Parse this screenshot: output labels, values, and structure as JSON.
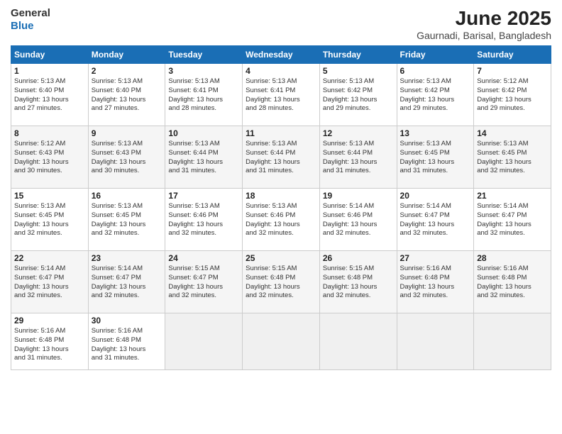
{
  "header": {
    "logo_line1": "General",
    "logo_line2": "Blue",
    "month": "June 2025",
    "location": "Gaurnadi, Barisal, Bangladesh"
  },
  "weekdays": [
    "Sunday",
    "Monday",
    "Tuesday",
    "Wednesday",
    "Thursday",
    "Friday",
    "Saturday"
  ],
  "weeks": [
    [
      {
        "day": "1",
        "info": "Sunrise: 5:13 AM\nSunset: 6:40 PM\nDaylight: 13 hours\nand 27 minutes."
      },
      {
        "day": "2",
        "info": "Sunrise: 5:13 AM\nSunset: 6:40 PM\nDaylight: 13 hours\nand 27 minutes."
      },
      {
        "day": "3",
        "info": "Sunrise: 5:13 AM\nSunset: 6:41 PM\nDaylight: 13 hours\nand 28 minutes."
      },
      {
        "day": "4",
        "info": "Sunrise: 5:13 AM\nSunset: 6:41 PM\nDaylight: 13 hours\nand 28 minutes."
      },
      {
        "day": "5",
        "info": "Sunrise: 5:13 AM\nSunset: 6:42 PM\nDaylight: 13 hours\nand 29 minutes."
      },
      {
        "day": "6",
        "info": "Sunrise: 5:13 AM\nSunset: 6:42 PM\nDaylight: 13 hours\nand 29 minutes."
      },
      {
        "day": "7",
        "info": "Sunrise: 5:12 AM\nSunset: 6:42 PM\nDaylight: 13 hours\nand 29 minutes."
      }
    ],
    [
      {
        "day": "8",
        "info": "Sunrise: 5:12 AM\nSunset: 6:43 PM\nDaylight: 13 hours\nand 30 minutes."
      },
      {
        "day": "9",
        "info": "Sunrise: 5:13 AM\nSunset: 6:43 PM\nDaylight: 13 hours\nand 30 minutes."
      },
      {
        "day": "10",
        "info": "Sunrise: 5:13 AM\nSunset: 6:44 PM\nDaylight: 13 hours\nand 31 minutes."
      },
      {
        "day": "11",
        "info": "Sunrise: 5:13 AM\nSunset: 6:44 PM\nDaylight: 13 hours\nand 31 minutes."
      },
      {
        "day": "12",
        "info": "Sunrise: 5:13 AM\nSunset: 6:44 PM\nDaylight: 13 hours\nand 31 minutes."
      },
      {
        "day": "13",
        "info": "Sunrise: 5:13 AM\nSunset: 6:45 PM\nDaylight: 13 hours\nand 31 minutes."
      },
      {
        "day": "14",
        "info": "Sunrise: 5:13 AM\nSunset: 6:45 PM\nDaylight: 13 hours\nand 32 minutes."
      }
    ],
    [
      {
        "day": "15",
        "info": "Sunrise: 5:13 AM\nSunset: 6:45 PM\nDaylight: 13 hours\nand 32 minutes."
      },
      {
        "day": "16",
        "info": "Sunrise: 5:13 AM\nSunset: 6:45 PM\nDaylight: 13 hours\nand 32 minutes."
      },
      {
        "day": "17",
        "info": "Sunrise: 5:13 AM\nSunset: 6:46 PM\nDaylight: 13 hours\nand 32 minutes."
      },
      {
        "day": "18",
        "info": "Sunrise: 5:13 AM\nSunset: 6:46 PM\nDaylight: 13 hours\nand 32 minutes."
      },
      {
        "day": "19",
        "info": "Sunrise: 5:14 AM\nSunset: 6:46 PM\nDaylight: 13 hours\nand 32 minutes."
      },
      {
        "day": "20",
        "info": "Sunrise: 5:14 AM\nSunset: 6:47 PM\nDaylight: 13 hours\nand 32 minutes."
      },
      {
        "day": "21",
        "info": "Sunrise: 5:14 AM\nSunset: 6:47 PM\nDaylight: 13 hours\nand 32 minutes."
      }
    ],
    [
      {
        "day": "22",
        "info": "Sunrise: 5:14 AM\nSunset: 6:47 PM\nDaylight: 13 hours\nand 32 minutes."
      },
      {
        "day": "23",
        "info": "Sunrise: 5:14 AM\nSunset: 6:47 PM\nDaylight: 13 hours\nand 32 minutes."
      },
      {
        "day": "24",
        "info": "Sunrise: 5:15 AM\nSunset: 6:47 PM\nDaylight: 13 hours\nand 32 minutes."
      },
      {
        "day": "25",
        "info": "Sunrise: 5:15 AM\nSunset: 6:48 PM\nDaylight: 13 hours\nand 32 minutes."
      },
      {
        "day": "26",
        "info": "Sunrise: 5:15 AM\nSunset: 6:48 PM\nDaylight: 13 hours\nand 32 minutes."
      },
      {
        "day": "27",
        "info": "Sunrise: 5:16 AM\nSunset: 6:48 PM\nDaylight: 13 hours\nand 32 minutes."
      },
      {
        "day": "28",
        "info": "Sunrise: 5:16 AM\nSunset: 6:48 PM\nDaylight: 13 hours\nand 32 minutes."
      }
    ],
    [
      {
        "day": "29",
        "info": "Sunrise: 5:16 AM\nSunset: 6:48 PM\nDaylight: 13 hours\nand 31 minutes."
      },
      {
        "day": "30",
        "info": "Sunrise: 5:16 AM\nSunset: 6:48 PM\nDaylight: 13 hours\nand 31 minutes."
      },
      {
        "day": "",
        "info": ""
      },
      {
        "day": "",
        "info": ""
      },
      {
        "day": "",
        "info": ""
      },
      {
        "day": "",
        "info": ""
      },
      {
        "day": "",
        "info": ""
      }
    ]
  ]
}
